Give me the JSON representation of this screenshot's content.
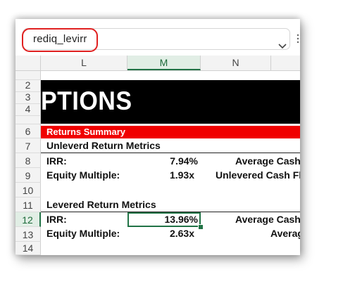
{
  "name_box": {
    "value": "rediq_levirr"
  },
  "columns": [
    {
      "label": "L",
      "active": false
    },
    {
      "label": "M",
      "active": true
    },
    {
      "label": "N",
      "active": false
    }
  ],
  "rows": [
    "2",
    "3",
    "4",
    "6",
    "7",
    "8",
    "9",
    "10",
    "11",
    "12",
    "13",
    "14"
  ],
  "active_row": "12",
  "sheet": {
    "title": "PTIONS",
    "section_header": "Returns Summary",
    "unlevered": {
      "heading": "Unleverd Return Metrics",
      "irr_label": "IRR:",
      "irr_value": "7.94%",
      "multiple_label": "Equity Multiple:",
      "multiple_value": "1.93x",
      "right_label_1": "Average Cash",
      "right_label_2": "Unlevered Cash Fl"
    },
    "levered": {
      "heading": "Levered Return Metrics",
      "irr_label": "IRR:",
      "irr_value": "13.96%",
      "multiple_label": "Equity Multiple:",
      "multiple_value": "2.63x",
      "right_label_1": "Average Cash",
      "right_label_2": "Averag"
    }
  },
  "colors": {
    "accent_green": "#217346",
    "header_red": "#f00000",
    "highlight_red": "#e02020"
  }
}
